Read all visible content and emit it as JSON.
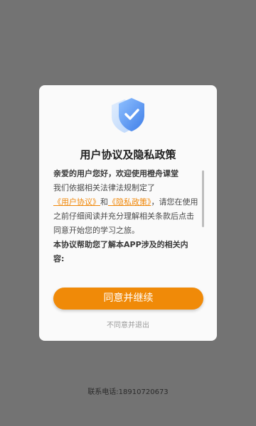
{
  "dialog": {
    "title": "用户协议及隐私政策",
    "greeting": "亲爱的用户您好，欢迎使用橙舟课堂",
    "body_prefix": "我们依据相关法律法规制定了",
    "user_agreement_link": "《用户协议》",
    "and_text": "和",
    "privacy_link": "《隐私政策》",
    "body_suffix": "，请您在使用之前仔细阅读并充分理解相关条款后点击同意开始您的学习之旅。",
    "section_heading": "本协议帮助您了解本APP涉及的相关内容:",
    "agree_label": "同意并继续",
    "decline_label": "不同意并退出",
    "shield_icon": "shield-check-icon"
  },
  "footer": {
    "contact": "联系电话:18910720673"
  },
  "colors": {
    "accent": "#f08a08",
    "overlay": "#737373",
    "shield": "#5b9cf0"
  }
}
